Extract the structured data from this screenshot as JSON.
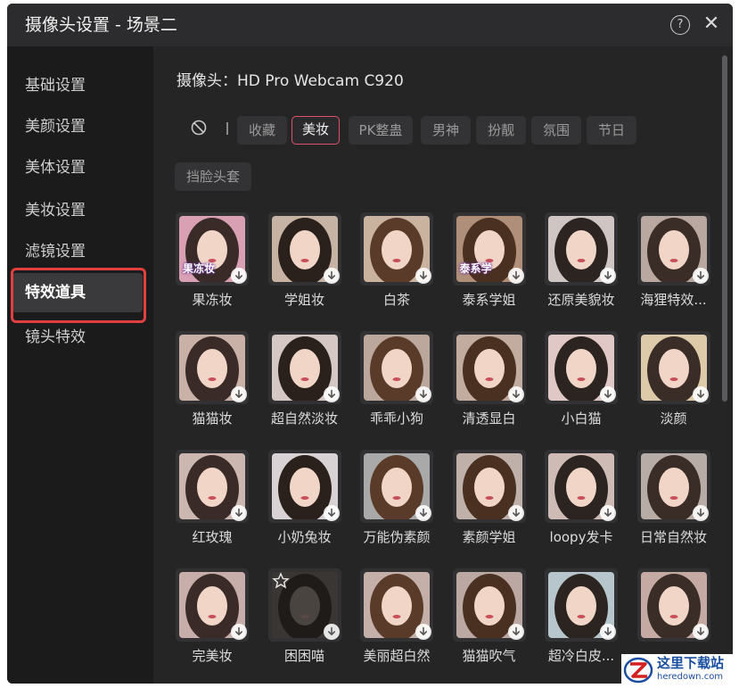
{
  "window": {
    "title": "摄像头设置 - 场景二",
    "help_symbol": "?",
    "close_symbol": "✕"
  },
  "sidebar": {
    "items": [
      {
        "label": "基础设置",
        "active": false
      },
      {
        "label": "美颜设置",
        "active": false
      },
      {
        "label": "美体设置",
        "active": false
      },
      {
        "label": "美妆设置",
        "active": false
      },
      {
        "label": "滤镜设置",
        "active": false
      },
      {
        "label": "特效道具",
        "active": true
      },
      {
        "label": "镜头特效",
        "active": false
      }
    ]
  },
  "camera": {
    "label": "摄像头：HD Pro Webcam C920"
  },
  "tabs": [
    {
      "label": "收藏",
      "active": false
    },
    {
      "label": "美妆",
      "active": true
    },
    {
      "label": "PK整蛊",
      "active": false
    },
    {
      "label": "男神",
      "active": false
    },
    {
      "label": "扮靓",
      "active": false
    },
    {
      "label": "氛围",
      "active": false
    },
    {
      "label": "节日",
      "active": false
    },
    {
      "label": "挡脸头套",
      "active": false
    }
  ],
  "effects": [
    {
      "name": "果冻妆",
      "badge": "果冻妆",
      "has_download": true,
      "favorite": false
    },
    {
      "name": "学姐妆",
      "badge": "",
      "has_download": true,
      "favorite": false
    },
    {
      "name": "白茶",
      "badge": "",
      "has_download": true,
      "favorite": false
    },
    {
      "name": "泰系学姐",
      "badge": "泰系学",
      "has_download": true,
      "favorite": false
    },
    {
      "name": "还原美貌妆",
      "badge": "",
      "has_download": true,
      "favorite": false
    },
    {
      "name": "海狸特效...",
      "badge": "",
      "has_download": true,
      "favorite": false
    },
    {
      "name": "猫猫妆",
      "badge": "",
      "has_download": true,
      "favorite": false
    },
    {
      "name": "超自然淡妆",
      "badge": "",
      "has_download": true,
      "favorite": false
    },
    {
      "name": "乖乖小狗",
      "badge": "",
      "has_download": true,
      "favorite": false
    },
    {
      "name": "清透显白",
      "badge": "",
      "has_download": true,
      "favorite": false
    },
    {
      "name": "小白猫",
      "badge": "",
      "has_download": true,
      "favorite": false
    },
    {
      "name": "淡颜",
      "badge": "",
      "has_download": true,
      "favorite": false
    },
    {
      "name": "红玫瑰",
      "badge": "",
      "has_download": true,
      "favorite": false
    },
    {
      "name": "小奶兔妆",
      "badge": "",
      "has_download": true,
      "favorite": false
    },
    {
      "name": "万能伪素颜",
      "badge": "",
      "has_download": true,
      "favorite": false
    },
    {
      "name": "素颜学姐",
      "badge": "",
      "has_download": true,
      "favorite": false
    },
    {
      "name": "loopy发卡",
      "badge": "",
      "has_download": true,
      "favorite": false
    },
    {
      "name": "日常自然妆",
      "badge": "",
      "has_download": true,
      "favorite": false
    },
    {
      "name": "完美妆",
      "badge": "",
      "has_download": true,
      "favorite": false
    },
    {
      "name": "困困喵",
      "badge": "",
      "has_download": true,
      "favorite": true
    },
    {
      "name": "美丽超白然",
      "badge": "",
      "has_download": true,
      "favorite": false
    },
    {
      "name": "猫猫吹气",
      "badge": "",
      "has_download": true,
      "favorite": false
    },
    {
      "name": "超冷白皮...",
      "badge": "",
      "has_download": true,
      "favorite": false
    },
    {
      "name": "",
      "badge": "",
      "has_download": true,
      "favorite": false
    }
  ],
  "watermark": {
    "text": "这里下载站",
    "subtext": "heredown.com"
  },
  "colors": {
    "accent": "#e0506a",
    "highlight_border": "#e0403f",
    "background": "#252526",
    "sidebar": "#1b1b1c"
  }
}
